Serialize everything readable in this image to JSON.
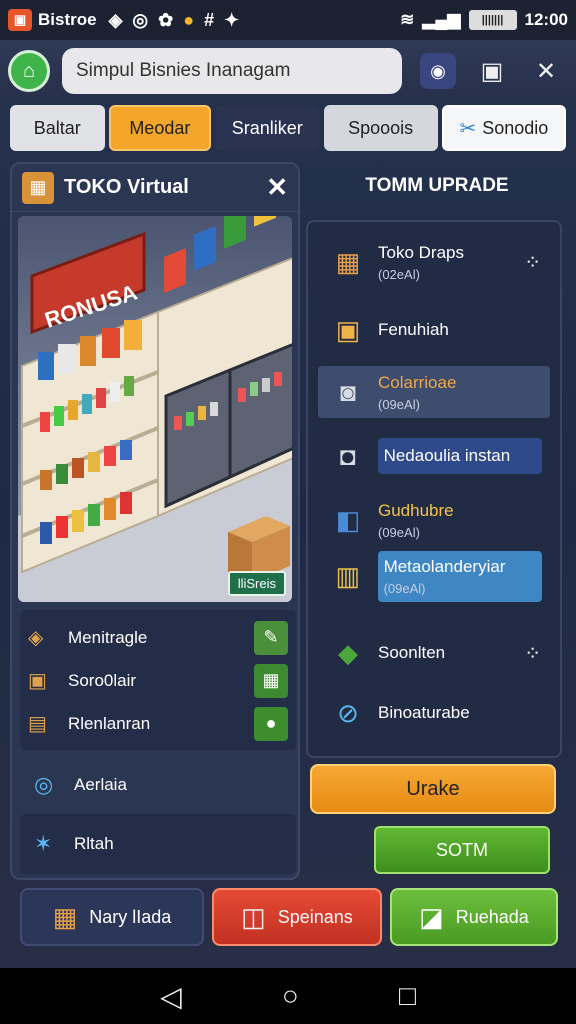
{
  "status_bar": {
    "app_label": "Bistroe",
    "time": "12:00",
    "battery_label": "|||||||"
  },
  "toolbar": {
    "search_text": "Simpul Bisnies Inanagam"
  },
  "tabs": [
    {
      "label": "Baltar"
    },
    {
      "label": "Meodar"
    },
    {
      "label": "Sranliker"
    },
    {
      "label": "Spooois"
    },
    {
      "label": "Sonodio"
    }
  ],
  "left_panel": {
    "title": "TOKO Virtual",
    "store_tag": "lliSreis",
    "items": [
      {
        "label": "Menitragle"
      },
      {
        "label": "Soro0lair"
      },
      {
        "label": "Rlenlanran"
      }
    ],
    "row1_label": "Aerlaia",
    "row2_label": "Rltah"
  },
  "right_panel": {
    "title": "TOMM UPRADE",
    "items": [
      {
        "name": "Toko Draps",
        "sub": "(02eAl)"
      },
      {
        "name": "Fenuhiah",
        "sub": ""
      },
      {
        "name": "Colarrioae",
        "sub": "(09eAl)"
      },
      {
        "name": "Nedaoulia instan",
        "sub": ""
      },
      {
        "name": "Gudhubre",
        "sub": "(09eAl)"
      },
      {
        "name": "Metaolanderyiar",
        "sub": "(09eAl)"
      },
      {
        "name": "Soonlten",
        "sub": ""
      },
      {
        "name": "Binoaturabe",
        "sub": ""
      }
    ]
  },
  "buttons": {
    "orange": "Urake",
    "green_small": "SOTM"
  },
  "bottom_actions": [
    {
      "label": "Nary lIada"
    },
    {
      "label": "Speinans"
    },
    {
      "label": "Ruehada"
    }
  ],
  "store_sign": "RONUSA"
}
